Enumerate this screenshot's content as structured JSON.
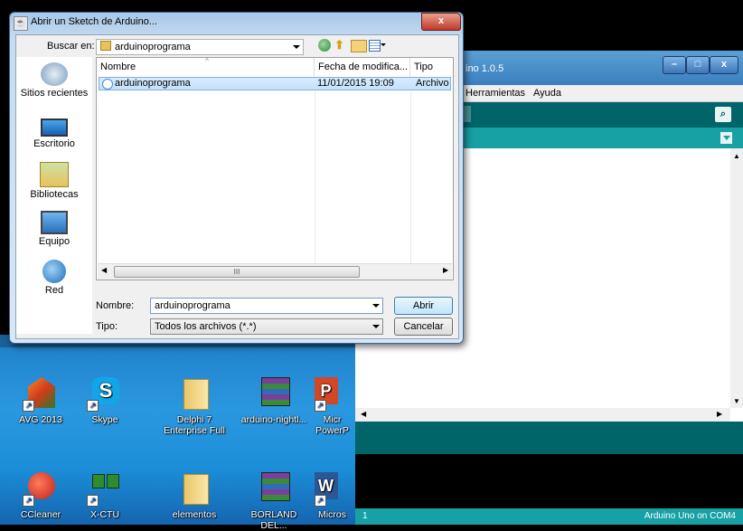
{
  "dialog": {
    "title": "Abrir un Sketch de Arduino...",
    "close_label": "x",
    "look_in_label": "Buscar en:",
    "look_in_value": "arduinoprograma",
    "places": [
      {
        "label": "Sitios recientes",
        "icon": "recent-places-icon"
      },
      {
        "label": "Escritorio",
        "icon": "desktop-icon"
      },
      {
        "label": "Bibliotecas",
        "icon": "libraries-icon"
      },
      {
        "label": "Equipo",
        "icon": "computer-icon"
      },
      {
        "label": "Red",
        "icon": "network-icon"
      }
    ],
    "columns": [
      "Nombre",
      "Fecha de modifica...",
      "Tipo"
    ],
    "files": [
      {
        "name": "arduinoprograma",
        "date": "11/01/2015 19:09",
        "type": "Archivo IN"
      }
    ],
    "scroll_grip": "III",
    "filename_label": "Nombre:",
    "filename_value": "arduinoprograma",
    "filetype_label": "Tipo:",
    "filetype_value": "Todos los archivos (*.*)",
    "open_label": "Abrir",
    "cancel_label": "Cancelar"
  },
  "arduino": {
    "title": "ino 1.0.5",
    "menu": [
      "Herramientas",
      "Ayuda"
    ],
    "status_line": "1",
    "board_status": "Arduino Uno on COM4",
    "minimize_label": "–",
    "maximize_label": "□",
    "close_label": "x"
  },
  "desktop": {
    "icons_row1": [
      {
        "label": "AVG 2013",
        "icon": "avg-icon"
      },
      {
        "label": "Skype",
        "icon": "skype-icon"
      },
      {
        "label": "Delphi 7 Enterprise Full",
        "icon": "folder-icon"
      },
      {
        "label": "arduino-nightl...",
        "icon": "winrar-archive-icon"
      },
      {
        "label": "Micr PowerP",
        "icon": "powerpoint-icon"
      }
    ],
    "icons_row2": [
      {
        "label": "CCleaner",
        "icon": "ccleaner-icon"
      },
      {
        "label": "X-CTU",
        "icon": "xctu-icon"
      },
      {
        "label": "elementos",
        "icon": "folder-icon"
      },
      {
        "label": "BORLAND DEL...",
        "icon": "winrar-archive-icon"
      },
      {
        "label": "Micros",
        "icon": "word-icon"
      }
    ]
  },
  "colors": {
    "arduino_dark": "#006468",
    "arduino_teal": "#17a1a5",
    "selection": "#c3e0fa"
  }
}
